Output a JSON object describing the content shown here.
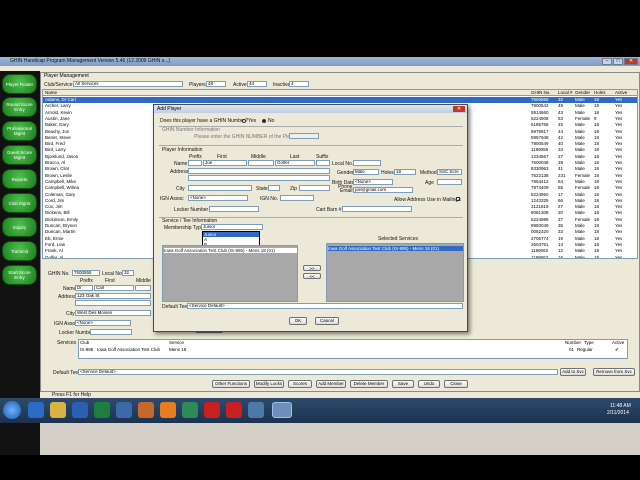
{
  "app": {
    "title": "GHIN Handicap Program Management Version 5.46 (12.2009 GHIN s...)",
    "window_controls": [
      "–",
      "□",
      "✕"
    ]
  },
  "sidebar": {
    "items": [
      {
        "label": "Player Roster"
      },
      {
        "label": "Round Score Entry"
      },
      {
        "label": "Professional Mgmt"
      },
      {
        "label": "Guest Score Mgmt"
      },
      {
        "label": "Reports"
      },
      {
        "label": "Club Mgmt"
      },
      {
        "label": "Inquiry"
      },
      {
        "label": "Transmit"
      },
      {
        "label": "Start Score Entry"
      }
    ]
  },
  "player_mgmt": {
    "caption": "Player Management",
    "club_service_label": "Club/Service",
    "club_service_value": "All Services",
    "players_label": "Players",
    "players_value": "48",
    "active_label": "Active",
    "active_value": "44",
    "inactive_label": "Inactive",
    "inactive_value": "4"
  },
  "grid": {
    "headers": [
      "Name",
      "GHIN No.",
      "Local #",
      "Gender",
      "Holes",
      "Active"
    ],
    "rows": [
      {
        "name": "Adams, Dr Carl",
        "ghin": "7500555",
        "local": "32",
        "gender": "Male",
        "holes": "18",
        "active": "Yes"
      },
      {
        "name": "Archer, Larry",
        "ghin": "7900543",
        "local": "49",
        "gender": "Male",
        "holes": "18",
        "active": "Yes"
      },
      {
        "name": "Arnold, Kevin",
        "ghin": "5914660",
        "local": "43",
        "gender": "Male",
        "holes": "18",
        "active": "Yes"
      },
      {
        "name": "Austin, Jane",
        "ghin": "5224908",
        "local": "53",
        "gender": "Female",
        "holes": "9",
        "active": "Yes"
      },
      {
        "name": "Baker, Gary",
        "ghin": "6185768",
        "local": "45",
        "gender": "Male",
        "holes": "18",
        "active": "Yes"
      },
      {
        "name": "Beachy, Jon",
        "ghin": "5979917",
        "local": "44",
        "gender": "Male",
        "holes": "18",
        "active": "Yes"
      },
      {
        "name": "Benet, Steve",
        "ghin": "5957948",
        "local": "42",
        "gender": "Male",
        "holes": "18",
        "active": "Yes"
      },
      {
        "name": "Bird, Fred",
        "ghin": "7900549",
        "local": "40",
        "gender": "Male",
        "holes": "18",
        "active": "Yes"
      },
      {
        "name": "Bird, Larry",
        "ghin": "1199056",
        "local": "34",
        "gender": "Male",
        "holes": "18",
        "active": "Yes"
      },
      {
        "name": "Bjorklund, Jason",
        "ghin": "1234567",
        "local": "27",
        "gender": "Male",
        "holes": "18",
        "active": "Yes"
      },
      {
        "name": "Bracco, Al",
        "ghin": "7500048",
        "local": "39",
        "gender": "Male",
        "holes": "18",
        "active": "Yes"
      },
      {
        "name": "Brown, Clint",
        "ghin": "8330963",
        "local": "41",
        "gender": "Male",
        "holes": "18",
        "active": "Yes"
      },
      {
        "name": "Brown, Leslie",
        "ghin": "7522138",
        "local": "231",
        "gender": "Female",
        "holes": "18",
        "active": "Yes"
      },
      {
        "name": "Campbell, Mike",
        "ghin": "7964412",
        "local": "54",
        "gender": "Male",
        "holes": "18",
        "active": "Yes"
      },
      {
        "name": "Campbell, Wilma",
        "ghin": "7974409",
        "local": "55",
        "gender": "Female",
        "holes": "18",
        "active": "Yes"
      },
      {
        "name": "Coleman, Gary",
        "ghin": "5224950",
        "local": "17",
        "gender": "Male",
        "holes": "18",
        "active": "Yes"
      },
      {
        "name": "Cord, Jim",
        "ghin": "1243325",
        "local": "66",
        "gender": "Male",
        "holes": "18",
        "active": "Yes"
      },
      {
        "name": "Cox, Jim",
        "ghin": "3121819",
        "local": "27",
        "gender": "Male",
        "holes": "18",
        "active": "Yes"
      },
      {
        "name": "Dickens, Bill",
        "ghin": "8081308",
        "local": "20",
        "gender": "Male",
        "holes": "18",
        "active": "Yes"
      },
      {
        "name": "Dickinson, Emily",
        "ghin": "5224988",
        "local": "37",
        "gender": "Female",
        "holes": "18",
        "active": "Yes"
      },
      {
        "name": "Duncan, Bryson",
        "ghin": "8950049",
        "local": "35",
        "gender": "Male",
        "holes": "18",
        "active": "Yes"
      },
      {
        "name": "Duncan, Martin",
        "ghin": "0082320",
        "local": "33",
        "gender": "Male",
        "holes": "18",
        "active": "Yes"
      },
      {
        "name": "Eb, Ernie",
        "ghin": "2706774",
        "local": "19",
        "gender": "Male",
        "holes": "18",
        "active": "Yes"
      },
      {
        "name": "Ford, Lew",
        "ghin": "2603751",
        "local": "14",
        "gender": "Male",
        "holes": "18",
        "active": "Yes"
      },
      {
        "name": "Frank, Al",
        "ghin": "1199062",
        "local": "12",
        "gender": "Male",
        "holes": "18",
        "active": "Yes"
      },
      {
        "name": "Golfer, Al",
        "ghin": "1199063",
        "local": "16",
        "gender": "Male",
        "holes": "18",
        "active": "Yes"
      }
    ]
  },
  "detail": {
    "ghin_label": "GHIN No.",
    "ghin_value": "7500555",
    "local_label": "Local No.",
    "local_value": "32",
    "name_label": "Name",
    "prefix_col": "Prefix",
    "first_col": "First",
    "middle_col": "Middle",
    "prefix_value": "Dr",
    "first_value": "Carl",
    "address_label": "Address",
    "address_value": "123 Oak St",
    "city_label": "City",
    "city_value": "West Des Moines",
    "ign_label": "IGN Assoc",
    "ign_value": "<None>",
    "locker_label": "Locker Number",
    "services_label": "Services",
    "svc_headers": [
      "Club",
      "Service",
      "Number",
      "Type",
      "Active"
    ],
    "svc_row": {
      "club": "IS-995",
      "club_name": "Iowa Golf Association Test Club",
      "service": "Mens 18",
      "number": "01",
      "type": "Regular",
      "active": "✔"
    },
    "default_tee_label": "Default Tee",
    "default_tee_value": "<Service Default>",
    "add_svc": "Add to Svc",
    "remove_svc": "Remove from Svc",
    "bottom_buttons": [
      "Other Functions",
      "Modify Locks",
      "Scores",
      "Add Member",
      "Delete Member",
      "Save",
      "Undo",
      "Close"
    ],
    "carl_btn": "Cart Btn"
  },
  "dialog": {
    "title": "Add Player",
    "has_ghin_q": "Does this player have a GHIN Number?",
    "yes_label": "Yes",
    "no_label": "No",
    "ghin_info_label": "GHIN Number Information",
    "enter_ghin_label": "Please enter the GHIN NUMBER of the Player:",
    "player_info_label": "Player Information",
    "prefix_col": "Prefix",
    "first_col": "First",
    "middle_col": "Middle",
    "last_col": "Last",
    "suffix_col": "Suffix",
    "name_label": "Name",
    "first_value": "Joe",
    "last_value": "Golfer",
    "address_label": "Address",
    "city_label": "City",
    "state_label": "State",
    "zip_label": "Zip",
    "ign_assoc_label": "IGN Assoc",
    "ign_assoc_value": "<None>",
    "ign_no_label": "IGN No.",
    "locker_label": "Locker Number",
    "local_no_label": "Local No.",
    "gender_label": "Gender",
    "gender_value": "Male",
    "holes_label": "Holes",
    "holes_value": "18",
    "method_label": "Method",
    "method_value": "SSC Scre",
    "birth_label": "Birth Date",
    "birth_value": "<None>",
    "age_label": "Age",
    "phone_label": "Phone",
    "email_label": "Email",
    "email_value": "joe@gmail.com",
    "allow_addr_label": "Allow Address Use in Mailings",
    "cart_label": "Cart Barn #",
    "svc_tee_label": "Service / Tee Information",
    "membership_label": "Membership Type",
    "membership_value": "Junior",
    "membership_options": [
      "Junior",
      "A",
      "B",
      "C",
      "D",
      "E",
      "F",
      "G",
      "H"
    ],
    "avail_item": "Iowa Golf Association Test Club (IS-995) - Mens 18 (01)",
    "selected_label": "Selected Services",
    "selected_item": "Iowa Golf Association Test Club (IS-995) - Mens 18 (01)",
    "default_tee_label": "Default Tee",
    "default_tee_value": "<Service Default>",
    "ok": "OK",
    "cancel": "Cancel",
    "arrow_left": "<<",
    "arrow_right": ">>"
  },
  "statusbar": {
    "text": "Press F1 for Help"
  },
  "taskbar": {
    "time": "11:48 AM",
    "date": "2/11/2014"
  }
}
